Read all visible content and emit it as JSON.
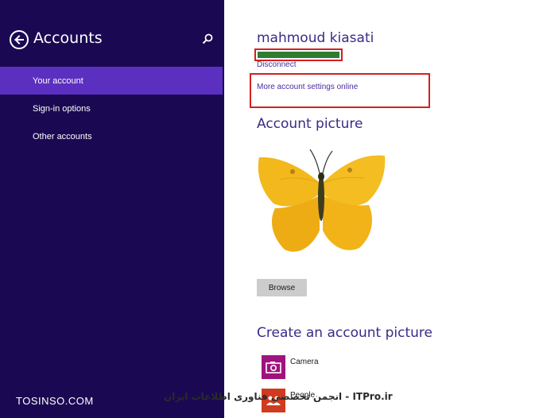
{
  "sidebar": {
    "title": "Accounts",
    "icons": {
      "back": "back-arrow-icon",
      "search": "search-icon"
    },
    "items": [
      {
        "label": "Your account",
        "active": true
      },
      {
        "label": "Sign-in options",
        "active": false
      },
      {
        "label": "Other accounts",
        "active": false
      }
    ]
  },
  "account": {
    "user_name": "mahmoud kiasati",
    "disconnect_label": "Disconnect",
    "more_settings_label": "More account settings online"
  },
  "account_picture": {
    "heading": "Account picture",
    "browse_label": "Browse"
  },
  "create_picture": {
    "heading": "Create an account picture",
    "apps": [
      {
        "label": "Camera",
        "icon": "camera-icon"
      },
      {
        "label": "People",
        "icon": "people-icon"
      }
    ]
  },
  "watermarks": {
    "left": "TOSINSO.COM",
    "right": "انجمن تخصصی فناوری اطلاعات ایران - ITPro.ir"
  },
  "colors": {
    "sidebar_bg": "#1a0952",
    "active_item": "#5b2fc0",
    "heading": "#3b2a86",
    "highlight_border": "#d42020",
    "camera_tile": "#a0137e",
    "people_tile": "#d03a1f"
  }
}
